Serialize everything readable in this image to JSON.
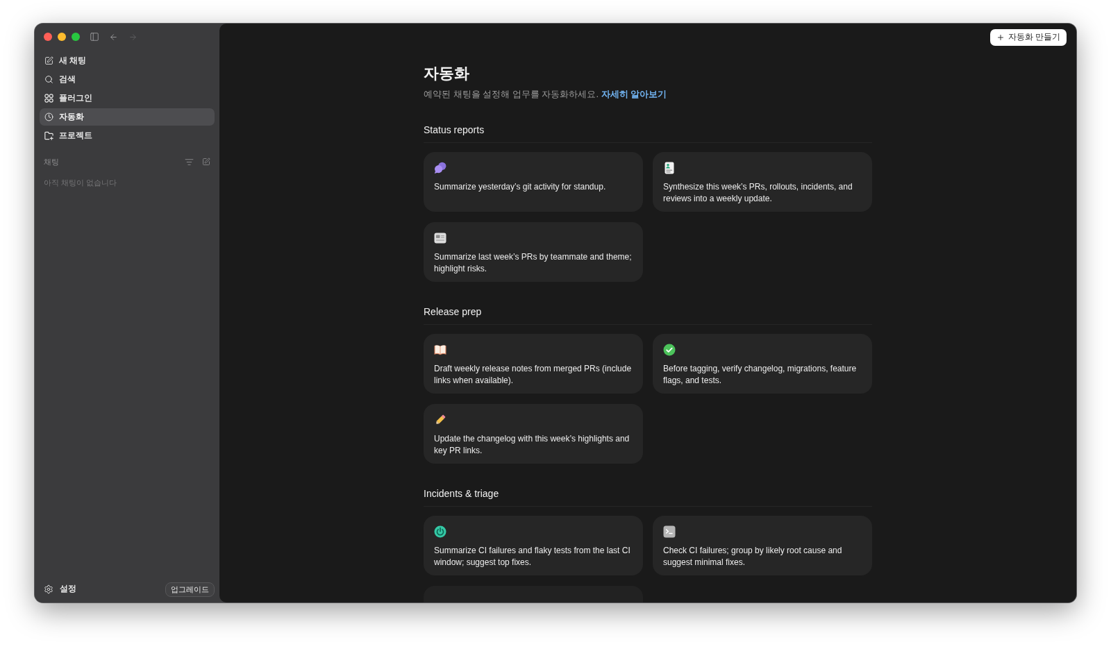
{
  "navigation": {
    "back": {
      "disabled": false
    },
    "forward": {
      "disabled": true
    }
  },
  "sidebar": {
    "items": [
      {
        "label": "새 채팅",
        "selected": false
      },
      {
        "label": "검색",
        "selected": false
      },
      {
        "label": "플러그인",
        "selected": false
      },
      {
        "label": "자동화",
        "selected": true
      },
      {
        "label": "프로젝트",
        "selected": false
      }
    ],
    "chats": {
      "title": "채팅",
      "empty_text": "아직 채팅이 없습니다"
    },
    "settings_label": "설정",
    "upgrade_button": "업그레이드"
  },
  "header": {
    "create_button": "자동화 만들기"
  },
  "page": {
    "title": "자동화",
    "subtitle": "예약된 채팅을 설정해 업무를 자동화하세요.",
    "link": "자세히 알아보기"
  },
  "sections": [
    {
      "title": "Status reports",
      "more_below": false,
      "cards": [
        {
          "text": "Summarize yesterday’s git activity for standup."
        },
        {
          "text": "Synthesize this week’s PRs, rollouts, incidents, and reviews into a weekly update."
        },
        {
          "text": "Summarize last week’s PRs by teammate and theme; highlight risks."
        }
      ]
    },
    {
      "title": "Release prep",
      "more_below": false,
      "cards": [
        {
          "text": "Draft weekly release notes from merged PRs (include links when available)."
        },
        {
          "text": "Before tagging, verify changelog, migrations, feature flags, and tests."
        },
        {
          "text": "Update the changelog with this week’s highlights and key PR links."
        }
      ]
    },
    {
      "title": "Incidents & triage",
      "more_below": true,
      "cards": [
        {
          "text": "Summarize CI failures and flaky tests from the last CI window; suggest top fixes."
        },
        {
          "text": "Check CI failures; group by likely root cause and suggest minimal fixes."
        }
      ]
    }
  ]
}
